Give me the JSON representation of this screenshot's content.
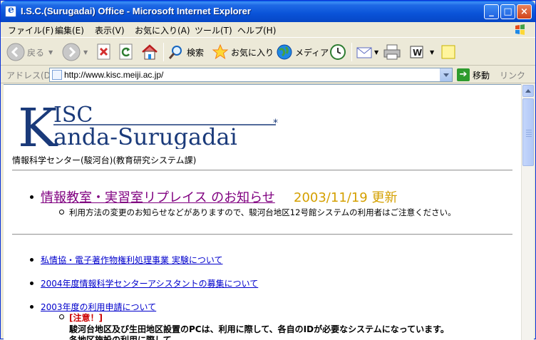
{
  "window": {
    "title": "I.S.C.(Surugadai) Office - Microsoft Internet Explorer",
    "minimize": "_",
    "maximize": "□",
    "close": "×"
  },
  "menu": [
    "ファイル(F)",
    "編集(E)",
    "表示(V)",
    "お気に入り(A)",
    "ツール(T)",
    "ヘルプ(H)"
  ],
  "toolbar": {
    "back": "戻る",
    "search": "検索",
    "favorites": "お気に入り",
    "media": "メディア"
  },
  "address": {
    "label": "アドレス(D)",
    "url": "http://www.kisc.meiji.ac.jp/",
    "go": "移動",
    "links": "リンク",
    "more": "»"
  },
  "page": {
    "logo_top": "ISC",
    "logo_k": "K",
    "logo_bottom": "anda-Surugadai",
    "logo_star": "*",
    "subtitle": "情報科学センター(駿河台)(教育研究システム課)",
    "headline_link": "情報教室・実習室リプレイス のお知らせ",
    "headline_date": "2003/11/19 更新",
    "headline_note": "利用方法の変更のお知らせなどがありますので、駿河台地区12号館システムの利用者はご注意ください。",
    "links": [
      "私情協・電子著作物権利処理事業 実験について",
      "2004年度情報科学センターアシスタントの募集について",
      "2003年度の利用申請について"
    ],
    "attention": "[注意！]",
    "attention_text": "駿河台地区及び生田地区設置のPCは、利用に際して、各自のIDが必要なシステムになっています。",
    "attention_text2": "各地区施設の利用に際して"
  },
  "colors": {
    "logo": "#1a3a7a",
    "visited_link": "#800080",
    "date": "#d4a000",
    "link": "#0000cc",
    "attention": "#cc0000"
  }
}
